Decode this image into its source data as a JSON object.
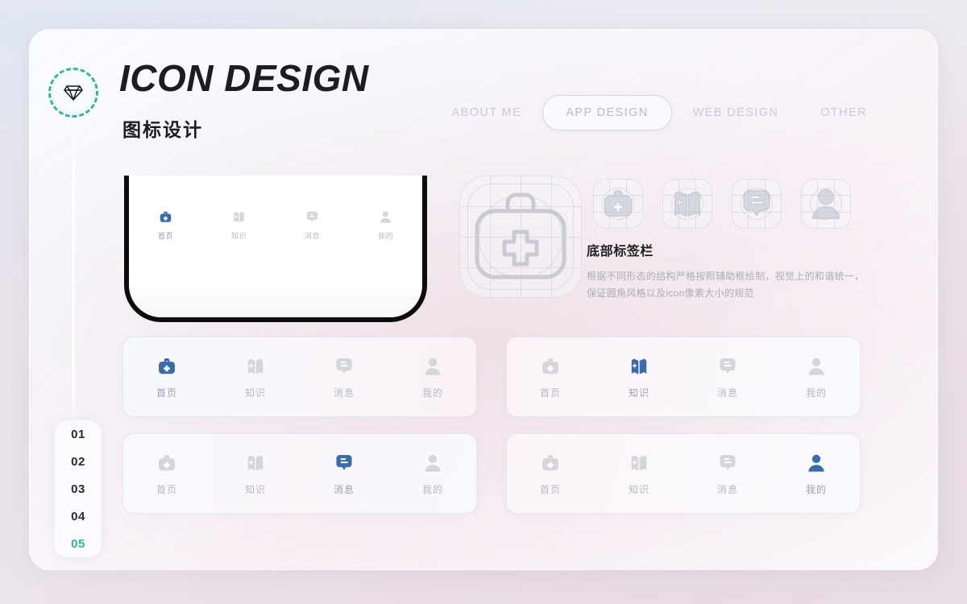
{
  "header": {
    "logo_icon": "diamond-icon",
    "title": "ICON DESIGN",
    "subtitle": "图标设计"
  },
  "nav": {
    "items": [
      {
        "label": "ABOUT ME",
        "active": false
      },
      {
        "label": "APP DESIGN",
        "active": true
      },
      {
        "label": "WEB DESIGN",
        "active": false
      },
      {
        "label": "OTHER",
        "active": false
      }
    ]
  },
  "pagination": {
    "items": [
      "01",
      "02",
      "03",
      "04",
      "05"
    ],
    "active": "05",
    "active_color": "#2eb69a"
  },
  "phone_mockup": {
    "tabs": [
      {
        "label": "首页",
        "icon": "briefcase-icon",
        "active": true
      },
      {
        "label": "知识",
        "icon": "book-icon",
        "active": false
      },
      {
        "label": "消息",
        "icon": "message-icon",
        "active": false
      },
      {
        "label": "我的",
        "icon": "person-icon",
        "active": false
      }
    ]
  },
  "guide": {
    "large_icon": "briefcase-guide-icon",
    "small_icons": [
      "briefcase-guide-icon",
      "book-guide-icon",
      "message-guide-icon",
      "person-guide-icon"
    ]
  },
  "description": {
    "title": "底部标签栏",
    "body": "根据不同形态的结构严格按照辅助框绘制，视觉上的和谐统一，保证圆角风格以及icon像素大小的规范"
  },
  "colors": {
    "active_blue": "#3a6bab",
    "inactive_grey": "#d4d6de",
    "accent_teal": "#2eb69a",
    "text_dark": "#1d1d1f",
    "text_muted": "#a9acb8"
  },
  "tab_cards": [
    {
      "active_index": 0,
      "tabs": [
        {
          "label": "首页",
          "icon": "briefcase-icon",
          "active": true
        },
        {
          "label": "知识",
          "icon": "book-icon",
          "active": false
        },
        {
          "label": "消息",
          "icon": "message-icon",
          "active": false
        },
        {
          "label": "我的",
          "icon": "person-icon",
          "active": false
        }
      ]
    },
    {
      "active_index": 1,
      "tabs": [
        {
          "label": "首页",
          "icon": "briefcase-icon",
          "active": false
        },
        {
          "label": "知识",
          "icon": "book-icon",
          "active": true
        },
        {
          "label": "消息",
          "icon": "message-icon",
          "active": false
        },
        {
          "label": "我的",
          "icon": "person-icon",
          "active": false
        }
      ]
    },
    {
      "active_index": 2,
      "tabs": [
        {
          "label": "首页",
          "icon": "briefcase-icon",
          "active": false
        },
        {
          "label": "知识",
          "icon": "book-icon",
          "active": false
        },
        {
          "label": "消息",
          "icon": "message-icon",
          "active": true
        },
        {
          "label": "我的",
          "icon": "person-icon",
          "active": false
        }
      ]
    },
    {
      "active_index": 3,
      "tabs": [
        {
          "label": "首页",
          "icon": "briefcase-icon",
          "active": false
        },
        {
          "label": "知识",
          "icon": "book-icon",
          "active": false
        },
        {
          "label": "消息",
          "icon": "message-icon",
          "active": false
        },
        {
          "label": "我的",
          "icon": "person-icon",
          "active": true
        }
      ]
    }
  ]
}
